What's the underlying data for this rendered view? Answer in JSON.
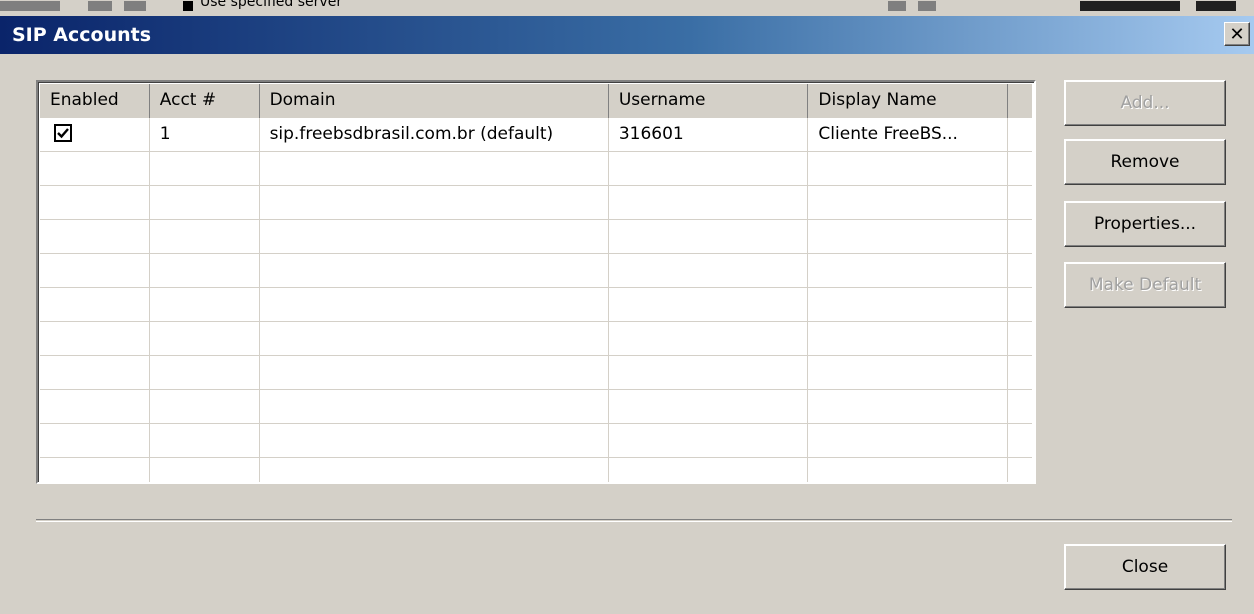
{
  "background_fragment": {
    "text": "Use specified server"
  },
  "window": {
    "title": "SIP Accounts",
    "close_glyph": "✕"
  },
  "table": {
    "columns": [
      "Enabled",
      "Acct #",
      "Domain",
      "Username",
      "Display Name"
    ],
    "rows": [
      {
        "enabled": true,
        "acct": "1",
        "domain": "sip.freebsdbrasil.com.br (default)",
        "username": "316601",
        "display_name": "Cliente FreeBS..."
      }
    ],
    "empty_rows": 10
  },
  "buttons": {
    "add": "Add...",
    "remove": "Remove",
    "properties": "Properties...",
    "make_default": "Make Default",
    "close": "Close"
  },
  "colors": {
    "dialog_bg": "#d4d0c8",
    "title_gradient_start": "#0a246a",
    "title_gradient_end": "#a6caf0",
    "disabled_text": "#a0a0a0"
  }
}
